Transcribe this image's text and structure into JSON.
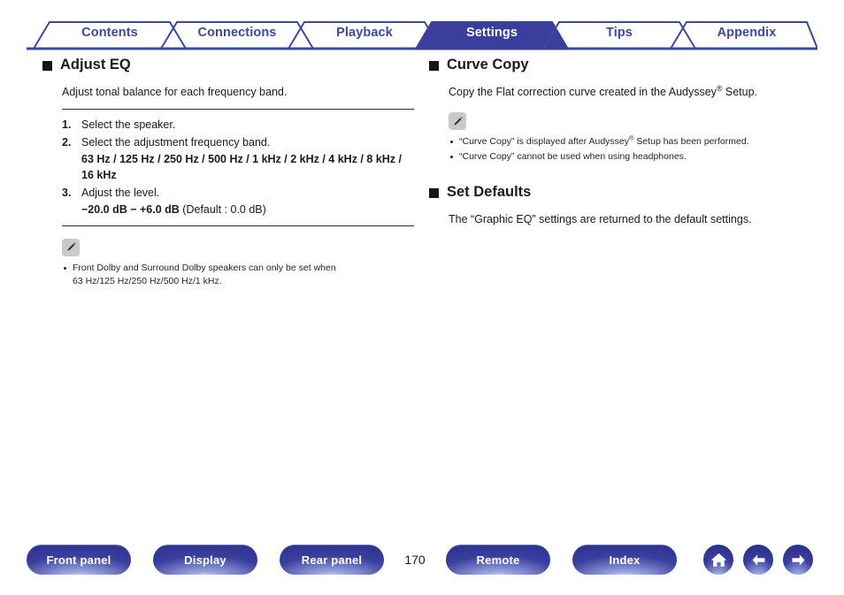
{
  "tabs": [
    {
      "label": "Contents",
      "active": false
    },
    {
      "label": "Connections",
      "active": false
    },
    {
      "label": "Playback",
      "active": false
    },
    {
      "label": "Settings",
      "active": true
    },
    {
      "label": "Tips",
      "active": false
    },
    {
      "label": "Appendix",
      "active": false
    }
  ],
  "colors": {
    "tab_blue": "#3c4a9c",
    "active_tab_fill": "#3a3f9e",
    "button_blue": "#3a3f9e",
    "text": "#1a1a1a",
    "note_icon_bg": "#c9c9c9"
  },
  "left_column": {
    "section": {
      "heading": "Adjust EQ",
      "lead": "Adjust tonal balance for each frequency band.",
      "steps": [
        {
          "num": "1.",
          "text": "Select the speaker.",
          "value": ""
        },
        {
          "num": "2.",
          "text": "Select the adjustment frequency band.",
          "value": "63 Hz / 125 Hz / 250 Hz / 500 Hz / 1 kHz / 2 kHz / 4 kHz / 8 kHz / 16 kHz"
        },
        {
          "num": "3.",
          "text": "Adjust the level.",
          "value": "−20.0 dB − +6.0 dB",
          "value_suffix": " (Default : 0.0 dB)"
        }
      ],
      "note": {
        "icon": "pencil-note-icon",
        "items": [
          {
            "line1": "Front Dolby and Surround Dolby speakers can only be set when",
            "line2": "63 Hz/125 Hz/250 Hz/500 Hz/1 kHz."
          }
        ]
      }
    }
  },
  "right_column": {
    "sections": [
      {
        "heading": "Curve Copy",
        "lead_pre": "Copy the Flat correction curve created in the Audyssey",
        "lead_sup": "®",
        "lead_post": " Setup.",
        "note": {
          "icon": "pencil-note-icon",
          "items": [
            {
              "pre": "“Curve Copy” is displayed after Audyssey",
              "sup": "®",
              "post": " Setup has been performed."
            },
            {
              "pre": "“Curve Copy” cannot be used when using headphones.",
              "sup": "",
              "post": ""
            }
          ]
        }
      },
      {
        "heading": "Set Defaults",
        "lead": "The “Graphic EQ” settings are returned to the default settings."
      }
    ]
  },
  "footer": {
    "buttons": [
      {
        "label": "Front panel"
      },
      {
        "label": "Display"
      },
      {
        "label": "Rear panel"
      },
      {
        "label": "Remote"
      },
      {
        "label": "Index"
      }
    ],
    "page_number": "170",
    "icons": [
      {
        "name": "home-icon"
      },
      {
        "name": "back-arrow-icon"
      },
      {
        "name": "forward-arrow-icon"
      }
    ]
  }
}
